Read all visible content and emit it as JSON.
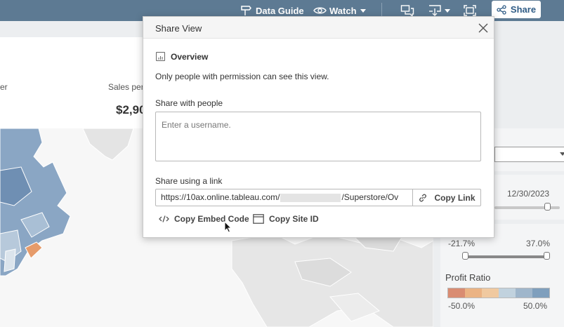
{
  "topbar": {
    "data_guide_label": "Data Guide",
    "watch_label": "Watch",
    "share_label": "Share"
  },
  "dashboard": {
    "kpi_label_partial_left": "er",
    "kpi_label_sales": "Sales per",
    "kpi_value_sales": "$2,90",
    "date_end": "12/30/2023",
    "range_min": "-21.7%",
    "range_max": "37.0%",
    "profit_ratio_title": "Profit Ratio",
    "profit_ratio_min": "-50.0%",
    "profit_ratio_max": "50.0%",
    "profit_ratio_colors": [
      "#d98c72",
      "#ebb384",
      "#f0c9a0",
      "#c1d2de",
      "#9fb6cb",
      "#7f9fbd"
    ]
  },
  "modal": {
    "title": "Share View",
    "overview_title": "Overview",
    "overview_desc": "Only people with permission can see this view.",
    "share_people_label": "Share with people",
    "username_placeholder": "Enter a username.",
    "share_link_label": "Share using a link",
    "link_prefix": "https://10ax.online.tableau.com/",
    "link_suffix": "/Superstore/Ov",
    "copy_link_label": "Copy Link",
    "copy_embed_label": "Copy Embed Code",
    "copy_site_label": "Copy Site ID"
  },
  "colors": {
    "topbar_bg": "#5d7a93",
    "share_text": "#2f5c86",
    "map_blue": "#8aa6c4"
  }
}
